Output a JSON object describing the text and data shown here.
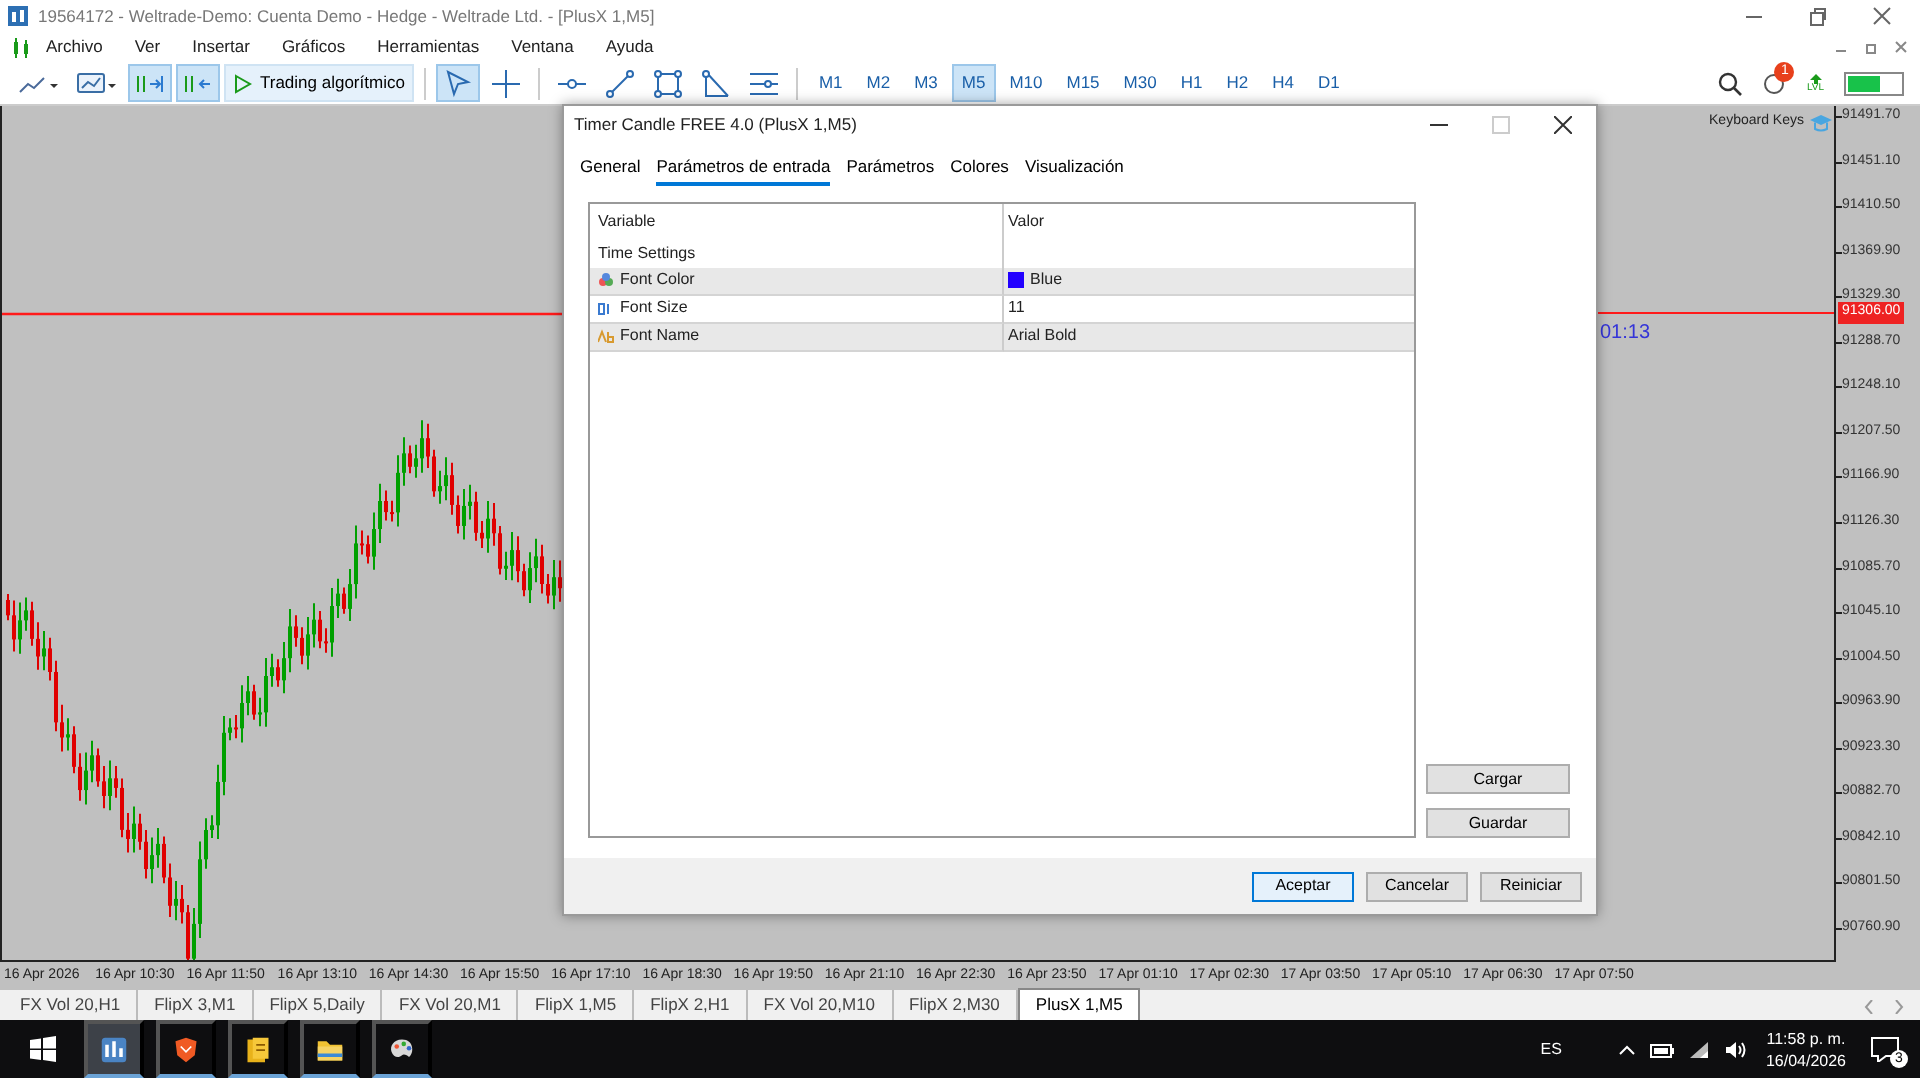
{
  "window": {
    "title": "19564172 - Weltrade-Demo: Cuenta Demo - Hedge - Weltrade Ltd. - [PlusX 1,M5]"
  },
  "menu": [
    "Archivo",
    "Ver",
    "Insertar",
    "Gráficos",
    "Herramientas",
    "Ventana",
    "Ayuda"
  ],
  "toolbar": {
    "tools": [
      {
        "kind": "chart-type",
        "selected": false
      },
      {
        "kind": "template",
        "selected": false
      },
      {
        "kind": "scroll",
        "selected": true
      },
      {
        "kind": "shift",
        "selected": true
      }
    ],
    "algo_trading": "Trading algorítmico",
    "drawing_tools": [
      {
        "kind": "cursor",
        "selected": true
      },
      {
        "kind": "crosshair",
        "selected": false
      },
      {
        "kind": "hline",
        "selected": false
      },
      {
        "kind": "trendline",
        "selected": false
      },
      {
        "kind": "rectangle",
        "selected": false
      },
      {
        "kind": "fibo",
        "selected": false
      },
      {
        "kind": "channels",
        "selected": false
      }
    ],
    "timeframes": [
      {
        "label": "M1",
        "selected": false
      },
      {
        "label": "M2",
        "selected": false
      },
      {
        "label": "M3",
        "selected": false
      },
      {
        "label": "M5",
        "selected": true
      },
      {
        "label": "M10",
        "selected": false
      },
      {
        "label": "M15",
        "selected": false
      },
      {
        "label": "M30",
        "selected": false
      },
      {
        "label": "H1",
        "selected": false
      },
      {
        "label": "H2",
        "selected": false
      },
      {
        "label": "H4",
        "selected": false
      },
      {
        "label": "D1",
        "selected": false
      }
    ],
    "notification_badge": "1",
    "signal_label": "LVL"
  },
  "chart": {
    "keyboard_keys": "Keyboard Keys",
    "timer": "01:13",
    "current_price": "91306.00",
    "price_labels": [
      "91491.70",
      "91451.10",
      "91410.50",
      "91369.90",
      "91329.30",
      "91288.70",
      "91248.10",
      "91207.50",
      "91166.90",
      "91126.30",
      "91085.70",
      "91045.10",
      "91004.50",
      "90963.90",
      "90923.30",
      "90882.70",
      "90842.10",
      "90801.50",
      "90760.90"
    ],
    "time_labels": [
      "16 Apr 2026",
      "16 Apr 10:30",
      "16 Apr 11:50",
      "16 Apr 13:10",
      "16 Apr 14:30",
      "16 Apr 15:50",
      "16 Apr 17:10",
      "16 Apr 18:30",
      "16 Apr 19:50",
      "16 Apr 21:10",
      "16 Apr 22:30",
      "16 Apr 23:50",
      "17 Apr 01:10",
      "17 Apr 02:30",
      "17 Apr 03:50",
      "17 Apr 05:10",
      "17 Apr 06:30",
      "17 Apr 07:50"
    ]
  },
  "dialog": {
    "title": "Timer Candle FREE 4.0 (PlusX 1,M5)",
    "tabs": [
      {
        "label": "General",
        "selected": false
      },
      {
        "label": "Parámetros de entrada",
        "selected": true
      },
      {
        "label": "Parámetros",
        "selected": false
      },
      {
        "label": "Colores",
        "selected": false
      },
      {
        "label": "Visualización",
        "selected": false
      }
    ],
    "columns": [
      "Variable",
      "Valor"
    ],
    "rows": [
      {
        "kind": "group",
        "variable": "Time Settings"
      },
      {
        "kind": "color",
        "variable": "Font Color",
        "value": "Blue",
        "color": "#2200ff"
      },
      {
        "kind": "number",
        "variable": "Font Size",
        "value": "11"
      },
      {
        "kind": "text",
        "variable": "Font Name",
        "value": "Arial Bold"
      }
    ],
    "side_buttons": [
      "Cargar",
      "Guardar"
    ],
    "buttons": [
      {
        "label": "Aceptar",
        "default": true
      },
      {
        "label": "Cancelar",
        "default": false
      },
      {
        "label": "Reiniciar",
        "default": false
      }
    ]
  },
  "chart_tabs": [
    {
      "label": "FX Vol 20,H1",
      "selected": false
    },
    {
      "label": "FlipX 3,M1",
      "selected": false
    },
    {
      "label": "FlipX 5,Daily",
      "selected": false
    },
    {
      "label": "FX Vol 20,M1",
      "selected": false
    },
    {
      "label": "FlipX 1,M5",
      "selected": false
    },
    {
      "label": "FlipX 2,H1",
      "selected": false
    },
    {
      "label": "FX Vol 20,M10",
      "selected": false
    },
    {
      "label": "FlipX 2,M30",
      "selected": false
    },
    {
      "label": "PlusX 1,M5",
      "selected": true
    }
  ],
  "taskbar": {
    "apps": [
      {
        "kind": "chart",
        "selected": true
      },
      {
        "kind": "shield",
        "selected": false
      },
      {
        "kind": "document",
        "selected": false
      },
      {
        "kind": "folder",
        "selected": false
      },
      {
        "kind": "palette",
        "selected": false
      }
    ],
    "language": "ES",
    "time": "11:58 p. m.",
    "date": "16/04/2026",
    "notification_count": "3"
  }
}
